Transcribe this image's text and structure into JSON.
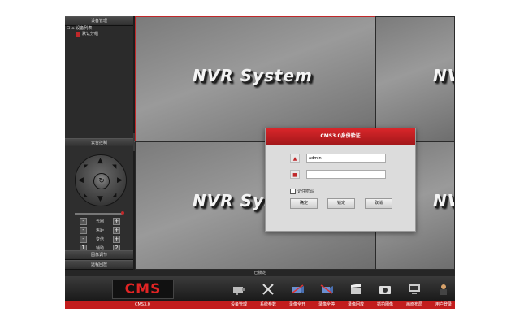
{
  "left_panel": {
    "device_header": "设备管理",
    "tree": {
      "root": "设备列表",
      "child": "默认分组"
    },
    "ptz_header": "云台控制",
    "controls": [
      {
        "label": "光圈",
        "minus": "-",
        "plus": "+"
      },
      {
        "label": "焦距",
        "minus": "-",
        "plus": "+"
      },
      {
        "label": "变倍",
        "minus": "-",
        "plus": "+"
      },
      {
        "label": "辅助",
        "minus": "1",
        "plus": "2"
      }
    ],
    "image_adjust": "图像调节",
    "remote_playback": "远程回放"
  },
  "video": {
    "brand_text": "NVR System"
  },
  "status_bar": {
    "text": "已锁定"
  },
  "toolbar": {
    "logo": "CMS",
    "version": "CMS3.0",
    "tools": [
      {
        "label": "设备管理",
        "icon": "camera-icon"
      },
      {
        "label": "系统参数",
        "icon": "tools-icon"
      },
      {
        "label": "录像全开",
        "icon": "record-on-icon"
      },
      {
        "label": "录像全停",
        "icon": "record-off-icon"
      },
      {
        "label": "录像回放",
        "icon": "clapper-icon"
      },
      {
        "label": "抓拍图像",
        "icon": "snapshot-icon"
      },
      {
        "label": "画面布局",
        "icon": "monitor-icon"
      },
      {
        "label": "用户登录",
        "icon": "user-icon"
      }
    ]
  },
  "login_dialog": {
    "title": "CMS3.0身份验证",
    "username_value": "admin",
    "password_value": "",
    "remember_label": "记住密码",
    "buttons": {
      "confirm": "确定",
      "lock": "锁定",
      "cancel": "取消"
    }
  },
  "colors": {
    "accent": "#c0282a",
    "toolbar_bar": "#c21d1d"
  }
}
